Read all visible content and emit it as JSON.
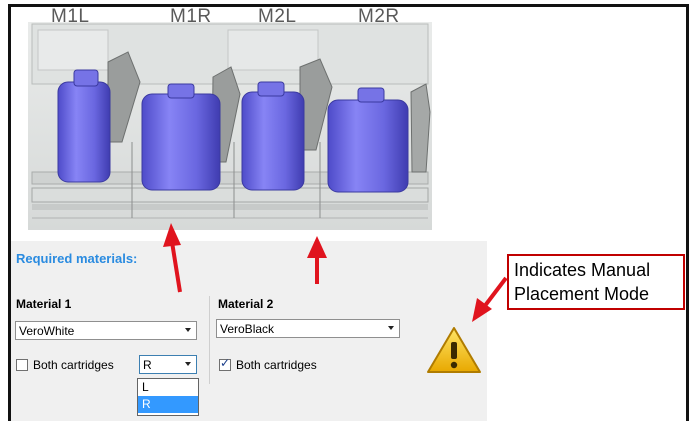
{
  "slots": [
    {
      "label": "M1L"
    },
    {
      "label": "M1R"
    },
    {
      "label": "M2L"
    },
    {
      "label": "M2R"
    }
  ],
  "panel": {
    "title": "Required materials:",
    "material1": {
      "label": "Material  1",
      "value": "VeroWhite",
      "both_cartridges_label": "Both cartridges",
      "both_cartridges_checked": false,
      "side_value": "R",
      "side_options": [
        "L",
        "R"
      ],
      "side_highlighted": "R"
    },
    "material2": {
      "label": "Material  2",
      "value": "VeroBlack",
      "both_cartridges_label": "Both cartridges",
      "both_cartridges_checked": true
    }
  },
  "callout": {
    "line1": "Indicates Manual",
    "line2": "Placement Mode"
  },
  "colors": {
    "accent_blue": "#2a8be0",
    "cartridge_purple": "#6f6de8",
    "arrow_red": "#e0141e",
    "callout_border": "#c00000",
    "warning_yellow": "#f2c200"
  },
  "icons": [
    "warning-icon",
    "chevron-down-icon",
    "checkmark-icon"
  ]
}
